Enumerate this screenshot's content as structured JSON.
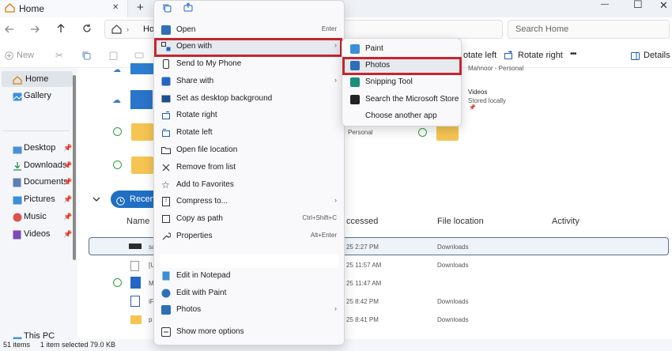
{
  "tab": {
    "title": "Home",
    "close": "✕",
    "new_tab": "+"
  },
  "window": {
    "minimize": "—",
    "maximize": "☐",
    "close": "✕"
  },
  "nav": {
    "address_partial": "Ho",
    "search_placeholder": "Search Home"
  },
  "commands": {
    "new": "New",
    "rotate_left": "otate left",
    "rotate_right": "Rotate right",
    "more": "•••",
    "details": "Details"
  },
  "sidebar": {
    "items": [
      {
        "label": "Home"
      },
      {
        "label": "Gallery"
      },
      {
        "label": "Desktop"
      },
      {
        "label": "Downloads"
      },
      {
        "label": "Documents"
      },
      {
        "label": "Pictures"
      },
      {
        "label": "Music"
      },
      {
        "label": "Videos"
      },
      {
        "label": "This PC"
      }
    ]
  },
  "content": {
    "quick_access": [
      {
        "title": "Mahnoor - Personal"
      },
      {
        "title": "Videos",
        "sub": "Stored locally"
      },
      {
        "sub": "Personal"
      }
    ],
    "recent_label": "Recent",
    "columns": {
      "name": "Name",
      "accessed": "ccessed",
      "location": "File location",
      "activity": "Activity"
    },
    "rows": [
      {
        "name": "sa",
        "date": "25 2:27 PM",
        "location": "Downloads"
      },
      {
        "name": "[U",
        "date": "25 11:57 AM",
        "location": "Downloads"
      },
      {
        "name": "M",
        "date": "25 11:47 AM",
        "location": ""
      },
      {
        "name": "iF",
        "date": "25 8:42 PM",
        "location": "Downloads"
      },
      {
        "name": "p",
        "date": "25 8:41 PM",
        "location": "Downloads"
      }
    ]
  },
  "status": {
    "items": "51 items",
    "selected": "1 item selected  79.0 KB"
  },
  "context_menu": {
    "open": "Open",
    "open_shortcut": "Enter",
    "open_with": "Open with",
    "send_phone": "Send to My Phone",
    "share_with": "Share with",
    "set_bg": "Set as desktop background",
    "rotate_right": "Rotate right",
    "rotate_left": "Rotate left",
    "open_location": "Open file location",
    "remove_list": "Remove from list",
    "add_fav": "Add to Favorites",
    "compress": "Compress to...",
    "copy_path": "Copy as path",
    "copy_path_shortcut": "Ctrl+Shift+C",
    "properties": "Properties",
    "properties_shortcut": "Alt+Enter",
    "edit_notepad": "Edit in Notepad",
    "edit_paint": "Edit with Paint",
    "photos": "Photos",
    "more_options": "Show more options"
  },
  "open_with_menu": {
    "paint": "Paint",
    "photos": "Photos",
    "snipping": "Snipping Tool",
    "store": "Search the Microsoft Store",
    "choose": "Choose another app"
  },
  "colors": {
    "highlight": "#c4262e",
    "accent": "#1f6fc4",
    "folder": "#f6c453"
  }
}
